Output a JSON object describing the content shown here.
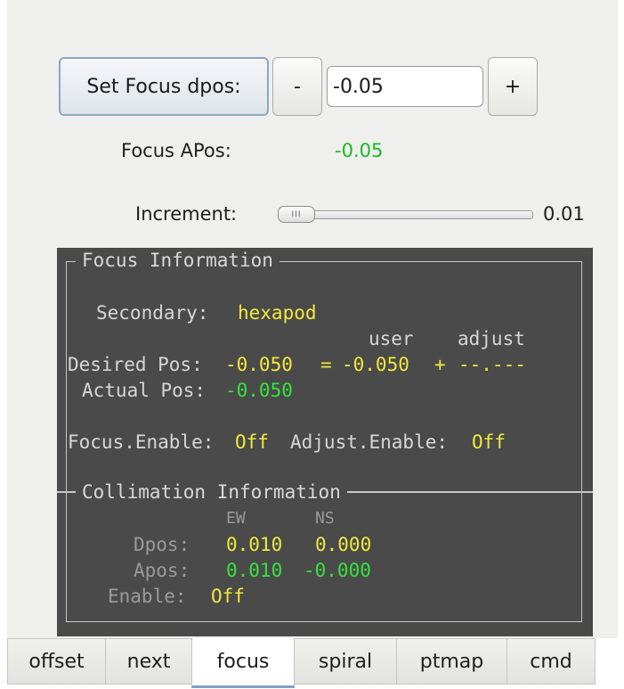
{
  "focus_control": {
    "set_button_label": "Set Focus dpos:",
    "minus_label": "-",
    "dpos_value": "-0.05",
    "plus_label": "+",
    "apos_label": "Focus APos:",
    "apos_value": "-0.05",
    "increment_label": "Increment:",
    "increment_value": "0.01",
    "slider_fraction": 0.0
  },
  "terminal": {
    "focus_title": "Focus Information",
    "secondary_label": "Secondary:",
    "secondary_value": "hexapod",
    "col_user": "user",
    "col_adjust": "adjust",
    "desired_label": "Desired Pos:",
    "desired_value": "-0.050",
    "eq": "=",
    "user_value": "-0.050",
    "plus": "+",
    "adjust_value": "--.---",
    "actual_label": "Actual Pos:",
    "actual_value": "-0.050",
    "focus_enable_label": "Focus.Enable:",
    "focus_enable_value": "Off",
    "adjust_enable_label": "Adjust.Enable:",
    "adjust_enable_value": "Off",
    "collimation_title": "Collimation Information",
    "col_ew": "EW",
    "col_ns": "NS",
    "dpos_label": "Dpos:",
    "dpos_ew": "0.010",
    "dpos_ns": "0.000",
    "apos_label": "Apos:",
    "apos_ew": "0.010",
    "apos_ns": "-0.000",
    "enable_label": "Enable:",
    "enable_value": "Off"
  },
  "tabs": [
    {
      "label": "offset"
    },
    {
      "label": "next"
    },
    {
      "label": "focus"
    },
    {
      "label": "spiral"
    },
    {
      "label": "ptmap"
    },
    {
      "label": "cmd"
    }
  ],
  "active_tab": "focus"
}
